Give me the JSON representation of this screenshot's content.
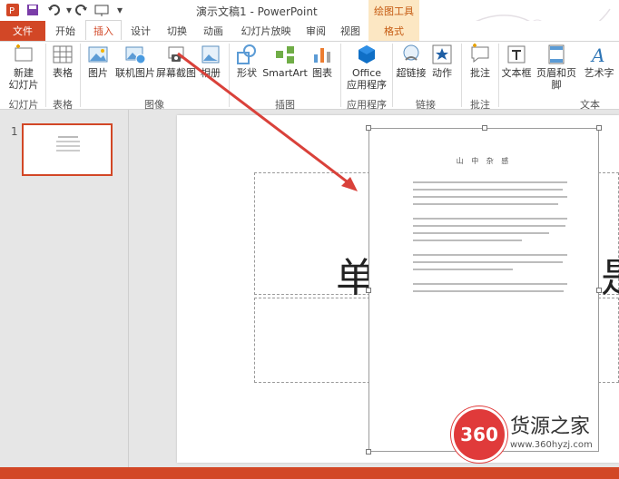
{
  "titlebar": {
    "title": "演示文稿1 - PowerPoint",
    "context_tools": "绘图工具"
  },
  "tabs": {
    "file": "文件",
    "items": [
      {
        "label": "开始"
      },
      {
        "label": "插入"
      },
      {
        "label": "设计"
      },
      {
        "label": "切换"
      },
      {
        "label": "动画"
      },
      {
        "label": "幻灯片放映"
      },
      {
        "label": "审阅"
      },
      {
        "label": "视图"
      },
      {
        "label": "格式"
      }
    ]
  },
  "ribbon": {
    "buttons": {
      "new_slide_1": "新建",
      "new_slide_2": "幻灯片",
      "table": "表格",
      "picture": "图片",
      "online_picture": "联机图片",
      "screenshot": "屏幕截图",
      "album": "相册",
      "shapes": "形状",
      "smartart": "SmartArt",
      "chart": "图表",
      "office_apps_1": "Office",
      "office_apps_2": "应用程序",
      "hyperlink": "超链接",
      "action": "动作",
      "comment": "批注",
      "textbox": "文本框",
      "header_footer": "页眉和页脚",
      "wordart": "艺术字"
    },
    "groups": {
      "slides": "幻灯片",
      "tables": "表格",
      "images": "图像",
      "illustrations": "插图",
      "apps": "应用程序",
      "links": "链接",
      "comments": "批注",
      "text": "文本"
    }
  },
  "thumbnails": [
    {
      "number": "1"
    }
  ],
  "slide": {
    "title_left": "单",
    "title_right": "是",
    "doc_title": "山 中 杂 感"
  },
  "watermark": {
    "logo": "360",
    "name": "货源之家",
    "url": "www.360hyzj.com"
  },
  "colors": {
    "accent": "#d24726",
    "context_tab": "#fce7c3"
  }
}
